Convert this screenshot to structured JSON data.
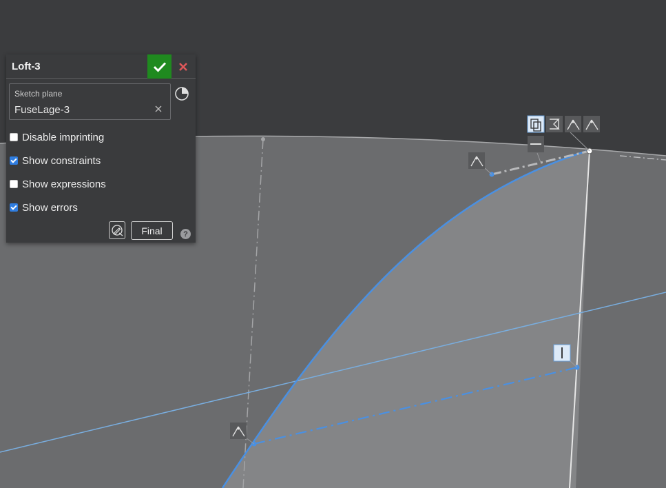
{
  "feature_panel": {
    "title": "Loft-3",
    "sketch_plane_label": "Sketch plane",
    "sketch_plane_value": "FuseLage-3",
    "options": [
      {
        "label": "Disable imprinting",
        "checked": false
      },
      {
        "label": "Show constraints",
        "checked": true
      },
      {
        "label": "Show expressions",
        "checked": false
      },
      {
        "label": "Show errors",
        "checked": true
      }
    ],
    "final_label": "Final",
    "help_glyph": "?"
  },
  "icons": {
    "accept": "checkmark-icon",
    "cancel": "close-icon",
    "clear": "clear-icon",
    "plane": "pie-chart-icon",
    "pencil": "sketch-pencil-icon",
    "help": "help-icon"
  },
  "colors": {
    "accept": "#1f8a1f",
    "cancel": "#e0585a",
    "selection": "#4a90e2",
    "background": "#3b3c3e",
    "surface": "#6b6c6e",
    "surface_light": "#848587"
  }
}
